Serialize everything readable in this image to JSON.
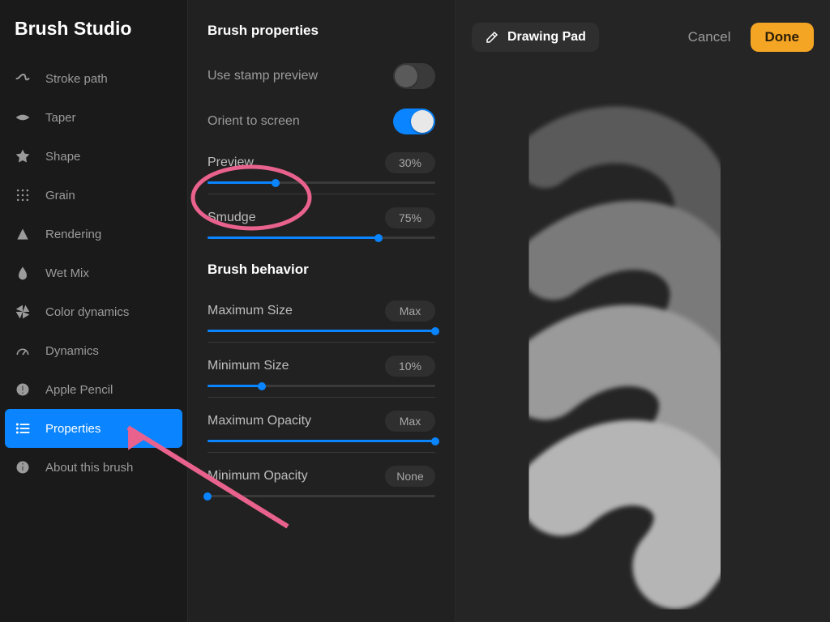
{
  "app": {
    "title": "Brush Studio"
  },
  "sidebar": {
    "items": [
      {
        "label": "Stroke path"
      },
      {
        "label": "Taper"
      },
      {
        "label": "Shape"
      },
      {
        "label": "Grain"
      },
      {
        "label": "Rendering"
      },
      {
        "label": "Wet Mix"
      },
      {
        "label": "Color dynamics"
      },
      {
        "label": "Dynamics"
      },
      {
        "label": "Apple Pencil"
      },
      {
        "label": "Properties"
      },
      {
        "label": "About this brush"
      }
    ],
    "active_index": 9
  },
  "settings": {
    "section_properties": "Brush properties",
    "section_behavior": "Brush behavior",
    "use_stamp_preview": {
      "label": "Use stamp preview",
      "on": false
    },
    "orient_to_screen": {
      "label": "Orient to screen",
      "on": true
    },
    "preview": {
      "label": "Preview",
      "value_text": "30%",
      "percent": 30
    },
    "smudge": {
      "label": "Smudge",
      "value_text": "75%",
      "percent": 75
    },
    "maximum_size": {
      "label": "Maximum Size",
      "value_text": "Max",
      "percent": 100
    },
    "minimum_size": {
      "label": "Minimum Size",
      "value_text": "10%",
      "percent": 24
    },
    "maximum_opacity": {
      "label": "Maximum Opacity",
      "value_text": "Max",
      "percent": 100
    },
    "minimum_opacity": {
      "label": "Minimum Opacity",
      "value_text": "None",
      "percent": 0
    }
  },
  "preview": {
    "drawing_pad": "Drawing Pad",
    "cancel": "Cancel",
    "done": "Done"
  },
  "annotation": {
    "highlight_oval_target": "smudge",
    "arrow_target": "properties-sidebar-item"
  }
}
